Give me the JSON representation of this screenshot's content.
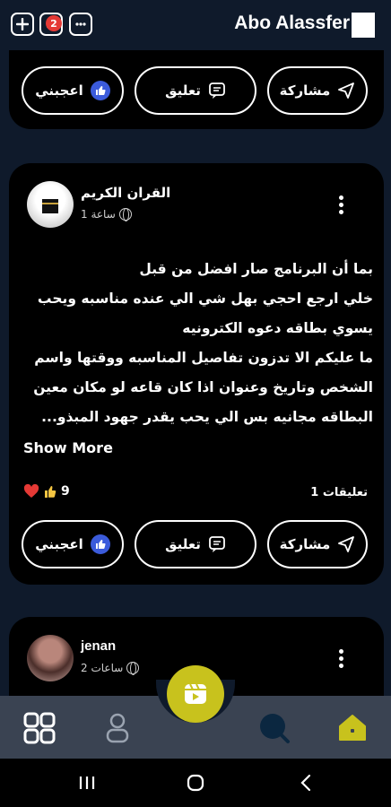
{
  "header": {
    "title": "Abo Alassfer",
    "notification_count": "2"
  },
  "actions": {
    "share": "مشاركة",
    "comment": "تعليق",
    "like": "اعجبني"
  },
  "posts": [
    {
      "author": "القران الكريم",
      "time": "ساعة 1",
      "lines": [
        "بما أن البرنامج صار افضل من قبل",
        "خلي ارجع احجي بهل شي  الي عنده مناسبه ويحب",
        "يسوي بطاقه دعوه الكترونيه",
        "ما عليكم الا تدزون تفاصيل المناسبه ووقتها واسم",
        "الشخص وتاريخ وعنوان اذا كان قاعه لو مكان معين",
        "البطاقه مجانيه بس الي يحب يقدر جهود المبذو..."
      ],
      "show_more": "Show More",
      "reaction_count": "9",
      "comments": "تعليقات 1"
    },
    {
      "author": "jenan",
      "time": "ساعات 2"
    }
  ],
  "nav": {
    "items": [
      "grid-icon",
      "profile-icon",
      "reels-icon",
      "search-icon",
      "home-icon"
    ]
  },
  "colors": {
    "background": "#0f1a2b",
    "card": "#000000",
    "accent": "#c8c21d",
    "like": "#3b5bdb",
    "badge": "#e53935"
  }
}
